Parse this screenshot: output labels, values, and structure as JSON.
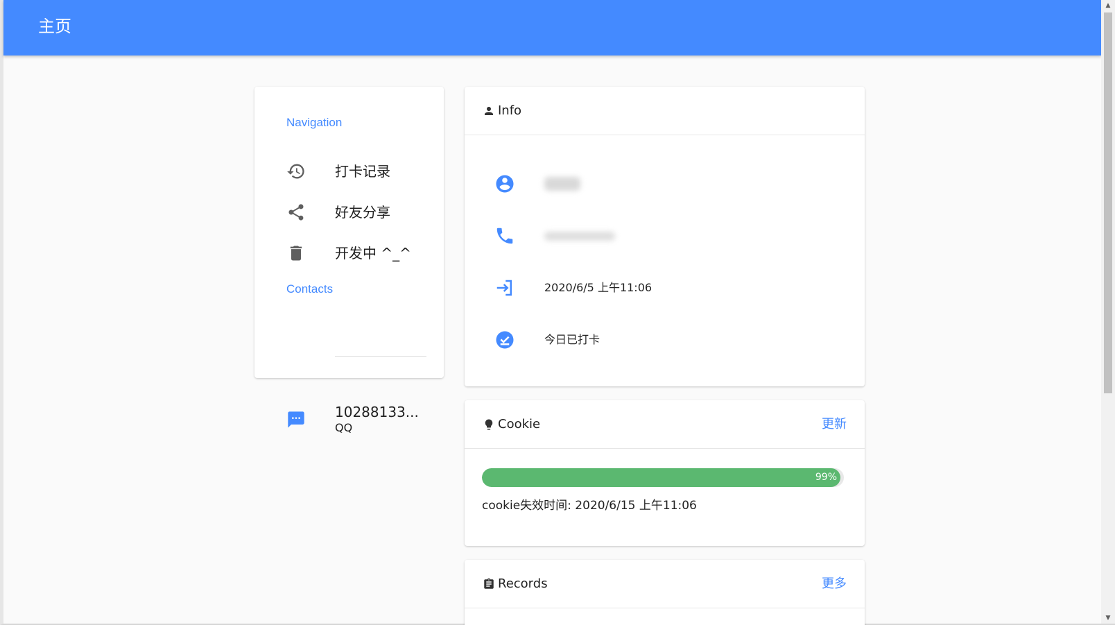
{
  "app": {
    "title": "主页",
    "accent_color": "#448aff"
  },
  "navigation": {
    "subheader": "Navigation",
    "items": [
      {
        "label": "打卡记录",
        "icon": "history-icon"
      },
      {
        "label": "好友分享",
        "icon": "share-icon"
      },
      {
        "label": "开发中 ^_^",
        "icon": "delete-icon"
      }
    ]
  },
  "contacts": {
    "subheader": "Contacts",
    "items": [
      {
        "value": "10288133...",
        "type": "QQ",
        "icon": "chat-icon"
      }
    ]
  },
  "info": {
    "title": "Info",
    "login_time": "2020/6/5 上午11:06",
    "checkin_status": "今日已打卡"
  },
  "cookie": {
    "title": "Cookie",
    "action": "更新",
    "progress_percent": 99,
    "progress_label": "99%",
    "progress_color": "#5bb870",
    "expire_text": "cookie失效时间: 2020/6/15 上午11:06"
  },
  "records": {
    "title": "Records",
    "action": "更多"
  }
}
